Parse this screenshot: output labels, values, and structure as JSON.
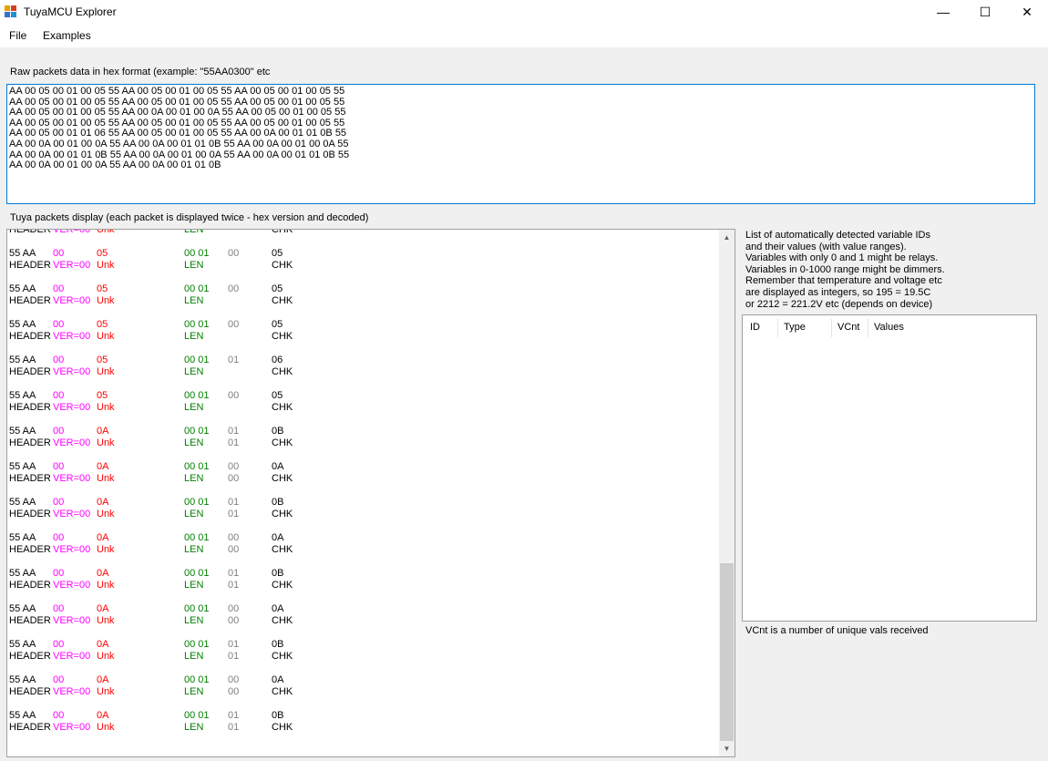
{
  "window": {
    "title": "TuyaMCU Explorer",
    "icon": "app-grid-icon",
    "minimize": "—",
    "maximize": "☐",
    "close": "✕"
  },
  "menu": {
    "items": [
      "File",
      "Examples"
    ]
  },
  "raw": {
    "label": "Raw packets data in hex format (example: \"55AA0300\" etc",
    "text": "AA 00 05 00 01 00 05 55 AA 00 05 00 01 00 05 55 AA 00 05 00 01 00 05 55\nAA 00 05 00 01 00 05 55 AA 00 05 00 01 00 05 55 AA 00 05 00 01 00 05 55\nAA 00 05 00 01 00 05 55 AA 00 0A 00 01 00 0A 55 AA 00 05 00 01 00 05 55\nAA 00 05 00 01 00 05 55 AA 00 05 00 01 00 05 55 AA 00 05 00 01 00 05 55\nAA 00 05 00 01 01 06 55 AA 00 05 00 01 00 05 55 AA 00 0A 00 01 01 0B 55\nAA 00 0A 00 01 00 0A 55 AA 00 0A 00 01 01 0B 55 AA 00 0A 00 01 00 0A 55\nAA 00 0A 00 01 01 0B 55 AA 00 0A 00 01 00 0A 55 AA 00 0A 00 01 01 0B 55\nAA 00 0A 00 01 00 0A 55 AA 00 0A 00 01 01 0B"
  },
  "packets": {
    "label": "Tuya packets display (each packet is displayed twice - hex version and decoded)",
    "partial": {
      "ver": "VER=00",
      "unk": "Unk",
      "len": "LEN",
      "chk": "CHK"
    },
    "labels": {
      "header_hex": "55 AA",
      "header_dec": "HEADER",
      "ver_dec": "VER=00",
      "unk_dec": "Unk",
      "len_dec": "LEN",
      "chk_dec": "CHK"
    },
    "rows": [
      {
        "ver": "00",
        "unk": "05",
        "len": "00 01",
        "d1": "00",
        "d2": "",
        "chk": "05"
      },
      {
        "ver": "00",
        "unk": "05",
        "len": "00 01",
        "d1": "00",
        "d2": "",
        "chk": "05"
      },
      {
        "ver": "00",
        "unk": "05",
        "len": "00 01",
        "d1": "00",
        "d2": "",
        "chk": "05"
      },
      {
        "ver": "00",
        "unk": "05",
        "len": "00 01",
        "d1": "01",
        "d2": "",
        "chk": "06"
      },
      {
        "ver": "00",
        "unk": "05",
        "len": "00 01",
        "d1": "00",
        "d2": "",
        "chk": "05"
      },
      {
        "ver": "00",
        "unk": "0A",
        "len": "00 01",
        "d1": "01",
        "d2": "01",
        "chk": "0B"
      },
      {
        "ver": "00",
        "unk": "0A",
        "len": "00 01",
        "d1": "00",
        "d2": "00",
        "chk": "0A"
      },
      {
        "ver": "00",
        "unk": "0A",
        "len": "00 01",
        "d1": "01",
        "d2": "01",
        "chk": "0B"
      },
      {
        "ver": "00",
        "unk": "0A",
        "len": "00 01",
        "d1": "00",
        "d2": "00",
        "chk": "0A"
      },
      {
        "ver": "00",
        "unk": "0A",
        "len": "00 01",
        "d1": "01",
        "d2": "01",
        "chk": "0B"
      },
      {
        "ver": "00",
        "unk": "0A",
        "len": "00 01",
        "d1": "00",
        "d2": "00",
        "chk": "0A"
      },
      {
        "ver": "00",
        "unk": "0A",
        "len": "00 01",
        "d1": "01",
        "d2": "01",
        "chk": "0B"
      },
      {
        "ver": "00",
        "unk": "0A",
        "len": "00 01",
        "d1": "00",
        "d2": "00",
        "chk": "0A"
      },
      {
        "ver": "00",
        "unk": "0A",
        "len": "00 01",
        "d1": "01",
        "d2": "01",
        "chk": "0B"
      }
    ],
    "scroll_up": "▲",
    "scroll_down": "▼",
    "scroll_position": 0.62
  },
  "vars": {
    "info": [
      "List of automatically detected variable IDs",
      "and their values (with value ranges).",
      "Variables with only 0 and 1 might be relays.",
      "Variables in 0-1000 range might be dimmers.",
      "Remember that temperature and voltage etc",
      "are displayed as integers, so 195 = 19.5C",
      "or 2212 = 221.2V etc (depends on device)"
    ],
    "columns": [
      "ID",
      "Type",
      "VCnt",
      "Values"
    ],
    "footer": "VCnt is a number of unique vals received"
  },
  "colors": {
    "accent": "#0078d7",
    "header": "#ff00ff",
    "unk": "#ff0000",
    "len": "#008000",
    "data": "#808080"
  }
}
